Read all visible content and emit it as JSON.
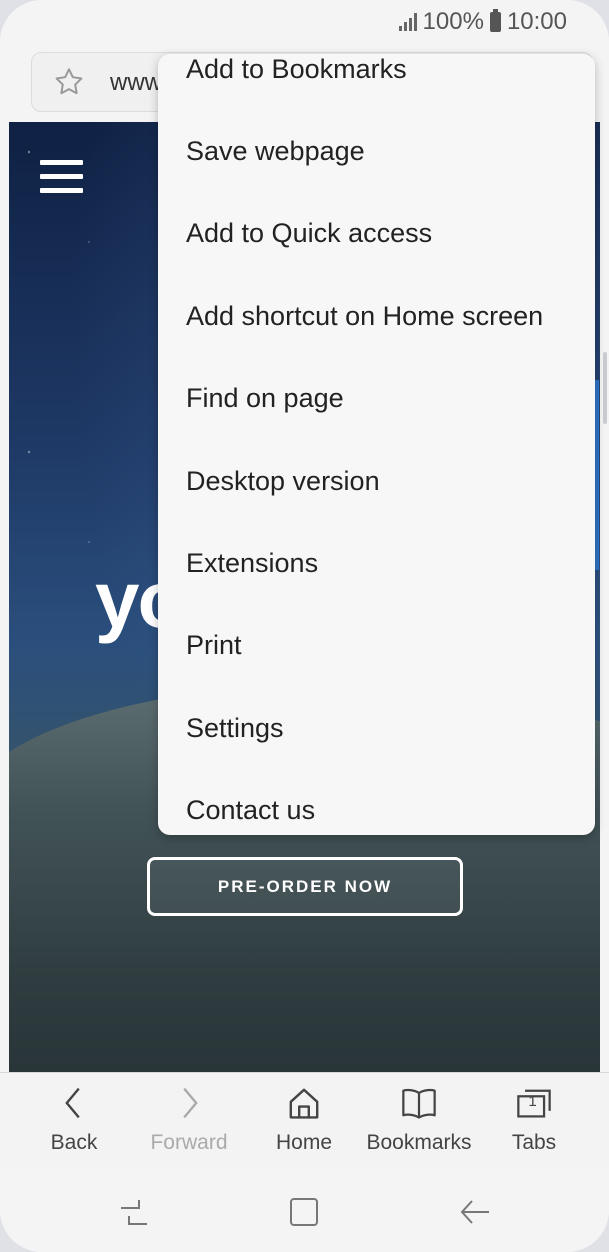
{
  "status": {
    "battery": "100%",
    "time": "10:00"
  },
  "urlbar": {
    "partial_text": "www"
  },
  "hero": {
    "headline_fragment": "yo",
    "preorder_label": "PRE-ORDER NOW"
  },
  "menu": {
    "items": [
      "Add to Bookmarks",
      "Save webpage",
      "Add to Quick access",
      "Add shortcut on Home screen",
      "Find on page",
      "Desktop version",
      "Extensions",
      "Print",
      "Settings",
      "Contact us"
    ]
  },
  "bottom_nav": {
    "back": "Back",
    "forward": "Forward",
    "home": "Home",
    "bookmarks": "Bookmarks",
    "tabs": "Tabs",
    "tab_count": "1"
  },
  "icons": {
    "bookmark_star": "star-outline",
    "menu": "hamburger",
    "signal": "signal-bars",
    "battery": "battery",
    "back": "chevron-left",
    "forward": "chevron-right",
    "home": "house-outline",
    "bookmarks": "open-book",
    "tabs": "stacked-tabs",
    "recents": "recents-lines",
    "system_home": "square",
    "system_back": "arrow-left"
  },
  "colors": {
    "accent_feedback": "#2f73c8",
    "menu_bg": "#f7f7f7",
    "text": "#222222"
  }
}
